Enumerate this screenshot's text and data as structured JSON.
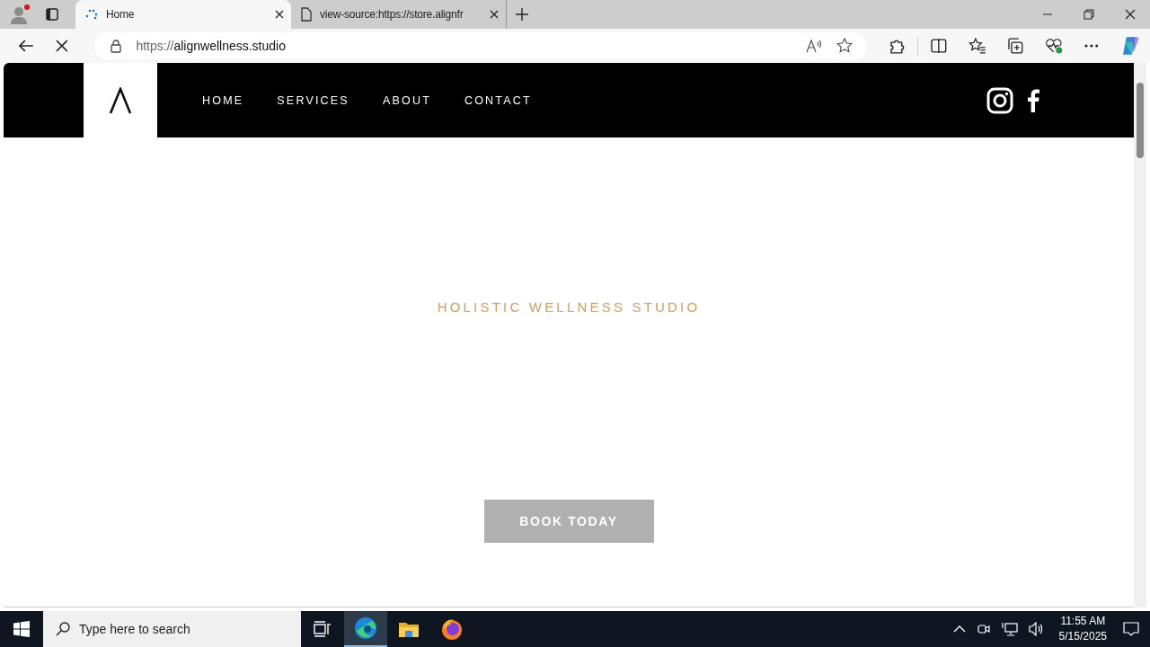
{
  "browser": {
    "tabs": [
      {
        "title": "Home",
        "kind": "loading",
        "selected": true
      },
      {
        "title": "view-source:https://store.alignfr",
        "kind": "page",
        "selected": false
      }
    ],
    "url_scheme": "https://",
    "url_host": "alignwellness.studio"
  },
  "site": {
    "nav": [
      {
        "label": "HOME"
      },
      {
        "label": "SERVICES"
      },
      {
        "label": "ABOUT"
      },
      {
        "label": "CONTACT"
      }
    ],
    "tagline": "HOLISTIC WELLNESS STUDIO",
    "button": "BOOK TODAY"
  },
  "taskbar": {
    "search_placeholder": "Type here to search",
    "time": "11:55 AM",
    "date": "5/15/2025"
  }
}
